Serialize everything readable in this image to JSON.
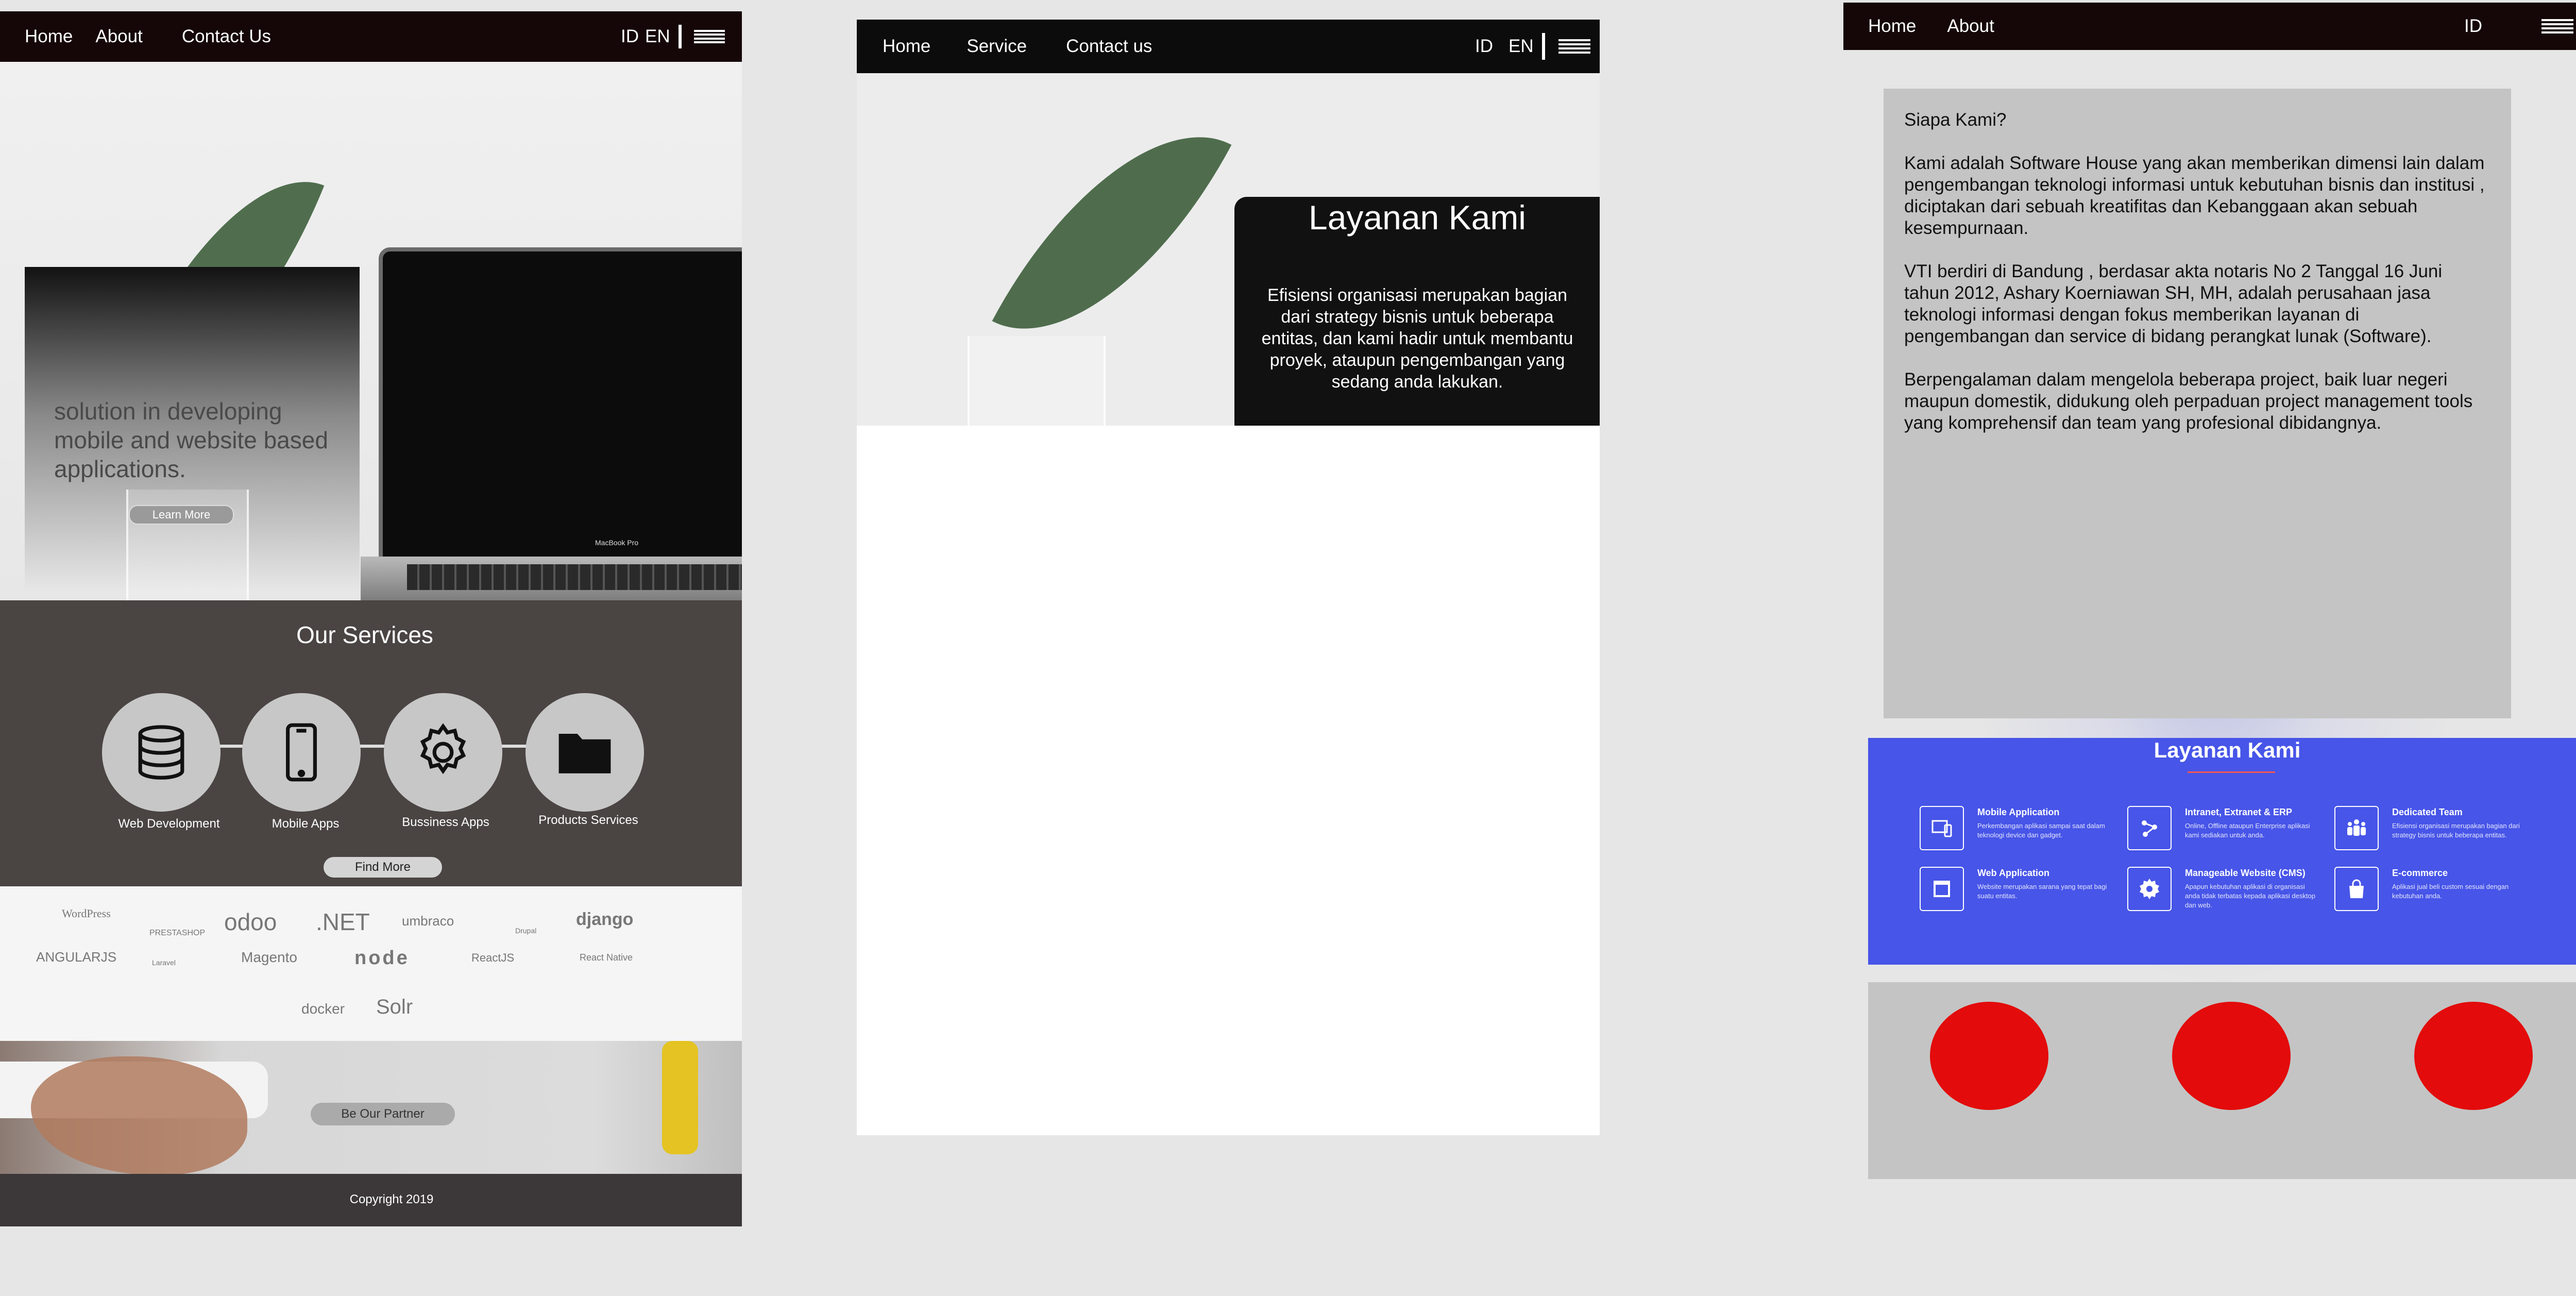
{
  "mockup1": {
    "nav": {
      "links": [
        "Home",
        "About",
        "Contact Us"
      ],
      "lang_id": "ID",
      "lang_en": "EN"
    },
    "hero": {
      "tagline": "solution in developing mobile and website based applications.",
      "button": "Learn More",
      "laptop_brand": "MacBook Pro"
    },
    "services": {
      "title": "Our Services",
      "items": [
        {
          "label": "Web Development",
          "icon": "database-icon"
        },
        {
          "label": "Mobile Apps",
          "icon": "mobile-phone-icon"
        },
        {
          "label": "Bussiness Apps",
          "icon": "gear-icon"
        },
        {
          "label": "Products Services",
          "icon": "folder-icon"
        }
      ],
      "button": "Find More"
    },
    "logos": [
      "WordPress",
      "PRESTASHOP",
      "odoo",
      ".NET",
      "umbraco",
      "Drupal",
      "django",
      "ANGULARJS",
      "Laravel",
      "Magento",
      "node",
      "ReactJS",
      "React Native",
      "docker",
      "Solr"
    ],
    "partner": {
      "button": "Be Our Partner"
    },
    "footer": {
      "copyright": "Copyright 2019"
    }
  },
  "mockup2": {
    "nav": {
      "links": [
        "Home",
        "Service",
        "Contact us"
      ],
      "lang_id": "ID",
      "lang_en": "EN"
    },
    "hero": {
      "title": "Layanan Kami",
      "text": "Efisiensi organisasi merupakan bagian dari strategy bisnis untuk beberapa entitas, dan kami hadir untuk membantu proyek, ataupun pengembangan yang sedang anda lakukan."
    }
  },
  "mockup3": {
    "nav": {
      "links": [
        "Home",
        "About"
      ],
      "lang_id": "ID"
    },
    "about": {
      "heading": "Siapa Kami?",
      "p1": "Kami adalah Software House yang akan memberikan dimensi lain dalam pengembangan teknologi informasi untuk kebutuhan bisnis dan institusi , diciptakan dari sebuah kreatifitas dan Kebanggaan akan sebuah kesempurnaan.",
      "p2": "VTI berdiri di Bandung , berdasar akta notaris No 2 Tanggal 16 Juni tahun 2012, Ashary Koerniawan SH, MH, adalah perusahaan jasa teknologi informasi dengan fokus memberikan layanan di pengembangan dan service di bidang perangkat lunak (Software).",
      "p3": "Berpengalaman dalam mengelola beberapa project, baik luar negeri maupun domestik, didukung oleh perpaduan project management tools yang komprehensif dan team yang profesional dibidangnya."
    },
    "services": {
      "title": "Layanan Kami",
      "items": [
        {
          "title": "Mobile Application",
          "desc": "Perkembangan aplikasi sampai saat dalam teknologi device dan gadget.",
          "icon": "devices-icon"
        },
        {
          "title": "Intranet, Extranet & ERP",
          "desc": "Online, Offline ataupun Enterprise aplikasi kami sediakan untuk anda.",
          "icon": "network-icon"
        },
        {
          "title": "Dedicated Team",
          "desc": "Efisiensi organisasi merupakan bagian dari strategy bisnis untuk beberapa entitas.",
          "icon": "team-icon"
        },
        {
          "title": "Web Application",
          "desc": "Website merupakan sarana yang tepat bagi suatu entitas.",
          "icon": "browser-icon"
        },
        {
          "title": "Manageable Website (CMS)",
          "desc": "Apapun kebutuhan aplikasi di organisasi anda tidak terbatas kepada aplikasi desktop dan web.",
          "icon": "gear-icon"
        },
        {
          "title": "E-commerce",
          "desc": "Aplikasi jual beli custom sesuai dengan kebutuhan anda.",
          "icon": "shopping-bag-icon"
        }
      ]
    },
    "colors": {
      "accent_red": "#e32a1e",
      "blue": "#4755e8",
      "dot_red": "#e30b0b"
    }
  }
}
